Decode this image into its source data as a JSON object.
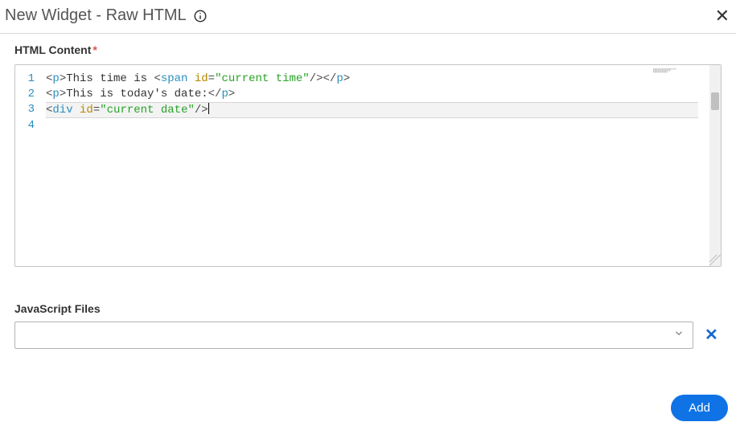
{
  "header": {
    "title": "New Widget - Raw HTML"
  },
  "html_section": {
    "label": "HTML Content",
    "required_marker": "*",
    "code_lines": [
      {
        "num": "1",
        "tokens": [
          {
            "t": "pun",
            "v": "<"
          },
          {
            "t": "tag",
            "v": "p"
          },
          {
            "t": "pun",
            "v": ">"
          },
          {
            "t": "txt",
            "v": "This time is "
          },
          {
            "t": "pun",
            "v": "<"
          },
          {
            "t": "tag",
            "v": "span"
          },
          {
            "t": "txt",
            "v": " "
          },
          {
            "t": "attr",
            "v": "id"
          },
          {
            "t": "pun",
            "v": "="
          },
          {
            "t": "str",
            "v": "\"current time\""
          },
          {
            "t": "pun",
            "v": "/>"
          },
          {
            "t": "pun",
            "v": "</"
          },
          {
            "t": "tag",
            "v": "p"
          },
          {
            "t": "pun",
            "v": ">"
          }
        ]
      },
      {
        "num": "2",
        "tokens": [
          {
            "t": "pun",
            "v": "<"
          },
          {
            "t": "tag",
            "v": "p"
          },
          {
            "t": "pun",
            "v": ">"
          },
          {
            "t": "txt",
            "v": "This is today's date:"
          },
          {
            "t": "pun",
            "v": "</"
          },
          {
            "t": "tag",
            "v": "p"
          },
          {
            "t": "pun",
            "v": ">"
          }
        ]
      },
      {
        "num": "3",
        "cursor": true,
        "tokens": [
          {
            "t": "pun",
            "v": "<"
          },
          {
            "t": "tag",
            "v": "div"
          },
          {
            "t": "txt",
            "v": " "
          },
          {
            "t": "attr",
            "v": "id"
          },
          {
            "t": "pun",
            "v": "="
          },
          {
            "t": "str",
            "v": "\"current date\""
          },
          {
            "t": "pun",
            "v": "/>"
          }
        ]
      },
      {
        "num": "4",
        "tokens": []
      }
    ]
  },
  "js_section": {
    "label": "JavaScript Files",
    "selected": ""
  },
  "footer": {
    "add_label": "Add"
  }
}
